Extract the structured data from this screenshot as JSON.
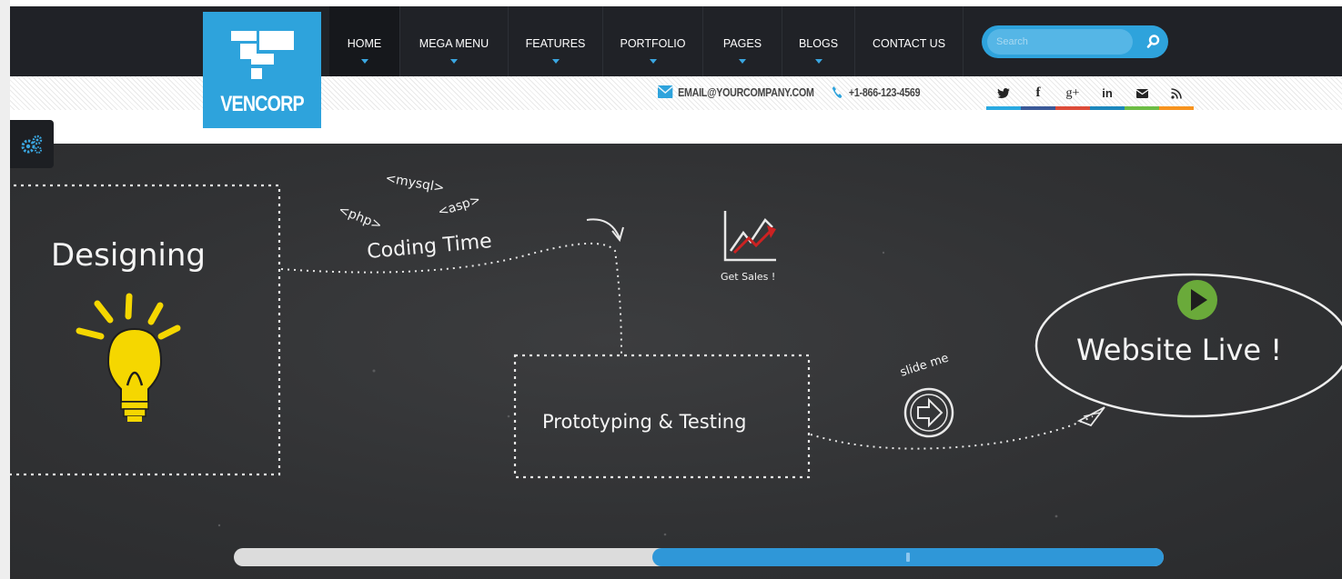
{
  "brand": {
    "logo_text": "VENCORP"
  },
  "nav": {
    "items": [
      {
        "label": "HOME",
        "active": true
      },
      {
        "label": "MEGA MENU",
        "active": false
      },
      {
        "label": "FEATURES",
        "active": false
      },
      {
        "label": "PORTFOLIO",
        "active": false
      },
      {
        "label": "PAGES",
        "active": false
      },
      {
        "label": "BLOGS",
        "active": false
      },
      {
        "label": "CONTACT US",
        "active": false
      }
    ]
  },
  "search": {
    "placeholder": "Search",
    "icon": "search-icon"
  },
  "contact": {
    "email": "EMAIL@YOURCOMPANY.COM",
    "phone": "+1-866-123-4569"
  },
  "social": [
    {
      "name": "twitter",
      "glyph": "t",
      "color": "#29a9e1"
    },
    {
      "name": "facebook",
      "glyph": "f",
      "color": "#3b5998"
    },
    {
      "name": "google-plus",
      "glyph": "g+",
      "color": "#dd4b39"
    },
    {
      "name": "linkedin",
      "glyph": "in",
      "color": "#1c87bd"
    },
    {
      "name": "email",
      "glyph": "✉",
      "color": "#6dbd45"
    },
    {
      "name": "rss",
      "glyph": "rss",
      "color": "#f7931e"
    }
  ],
  "colors": {
    "accent": "#2ea3dc",
    "topbar": "#202227",
    "hero_bg": "#333436",
    "slider_fill": "#2f97d8"
  },
  "hero": {
    "designing": "Designing",
    "coding_time": "Coding Time",
    "tag_php": "<php>",
    "tag_mysql": "<mysql>",
    "tag_asp": "<asp>",
    "get_sales": "Get Sales !",
    "prototyping": "Prototyping & Testing",
    "slide_me": "slide me",
    "website_live": "Website Live !"
  },
  "slider": {
    "progress": 0.45
  }
}
